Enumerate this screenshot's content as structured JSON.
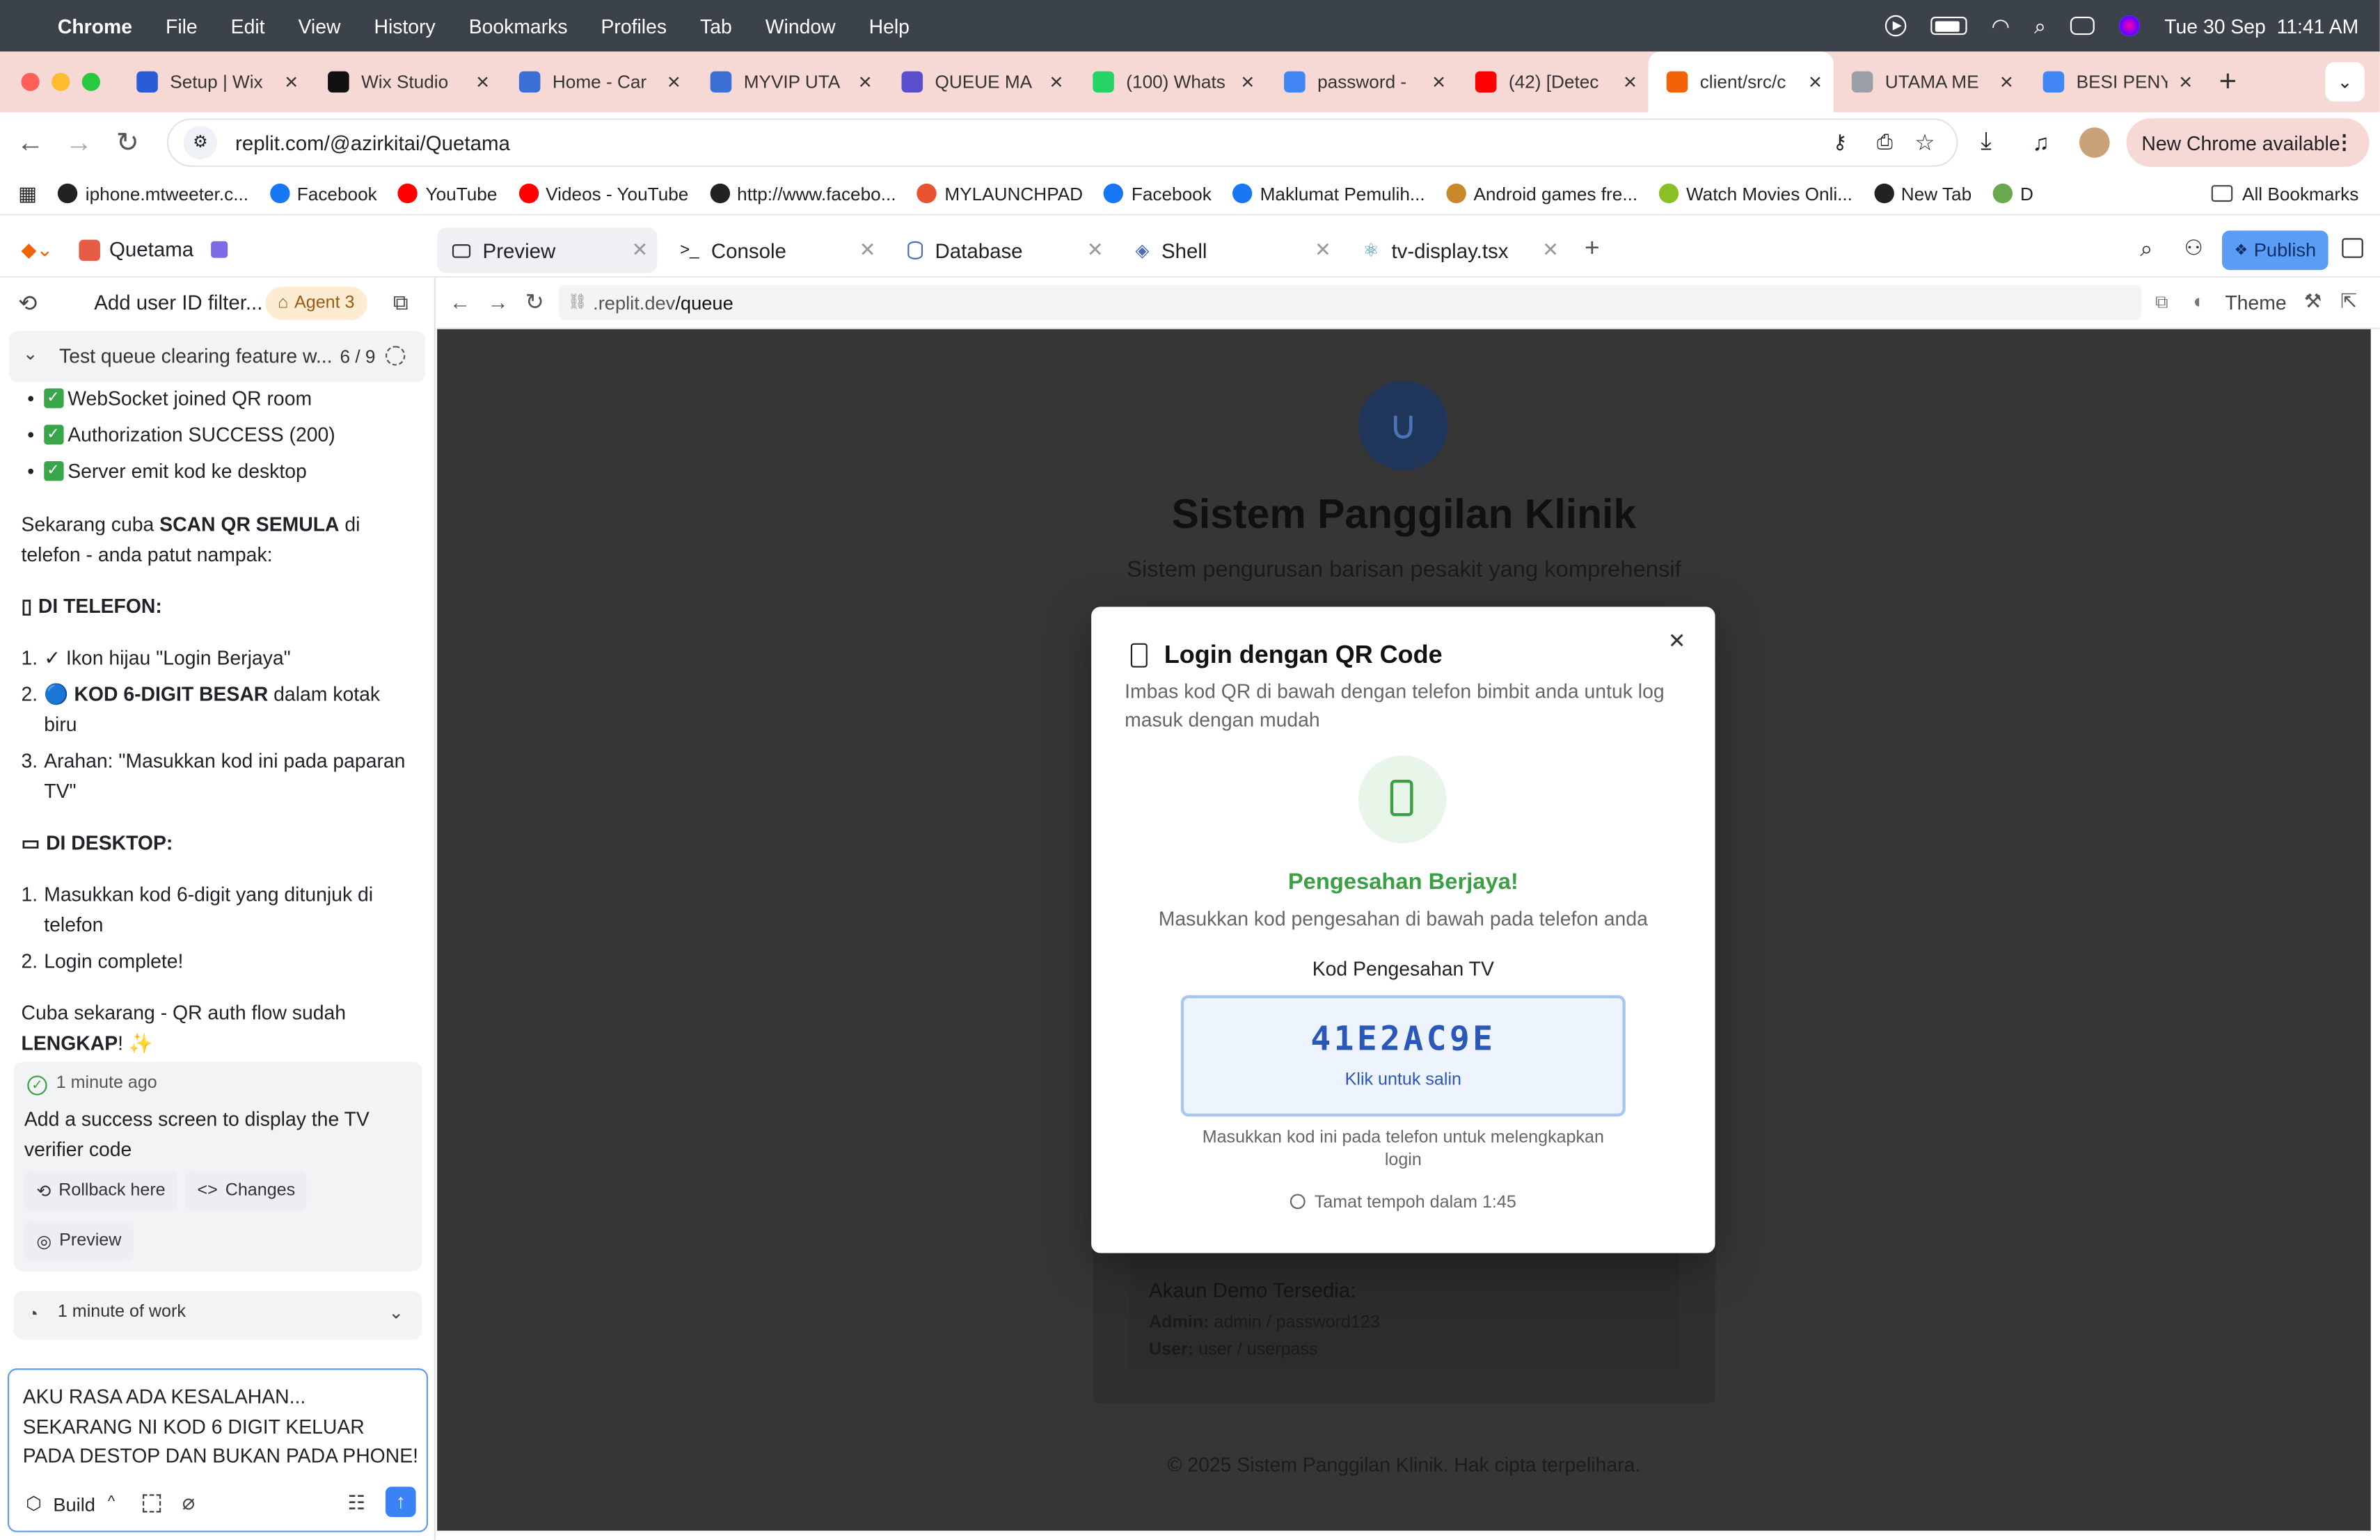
{
  "menubar": {
    "app": "Chrome",
    "items": [
      "File",
      "Edit",
      "View",
      "History",
      "Bookmarks",
      "Profiles",
      "Tab",
      "Window",
      "Help"
    ],
    "datetime": "Tue 30 Sep  11:41 AM"
  },
  "tabs": [
    {
      "title": "Setup | Wix",
      "color": "#2b5bd7"
    },
    {
      "title": "Wix Studio",
      "color": "#111111"
    },
    {
      "title": "Home - Car",
      "color": "#3b6fd6"
    },
    {
      "title": "MYVIP UTA",
      "color": "#3b6fd6"
    },
    {
      "title": "QUEUE MA",
      "color": "#5a4fcf"
    },
    {
      "title": "(100) Whats",
      "color": "#25d366"
    },
    {
      "title": "password -",
      "color": "#4285f4"
    },
    {
      "title": "(42) [Detec",
      "color": "#ff0000"
    },
    {
      "title": "client/src/c",
      "color": "#f26207"
    },
    {
      "title": "UTAMA ME",
      "color": "#9aa0a6"
    },
    {
      "title": "BESI PENYA",
      "color": "#4285f4"
    }
  ],
  "address": {
    "url": "replit.com/@azirkitai/Quetama",
    "update_label": "New Chrome available"
  },
  "bookmarks": [
    {
      "label": "iphone.mtweeter.c...",
      "color": "#222222"
    },
    {
      "label": "Facebook",
      "color": "#1877f2"
    },
    {
      "label": "YouTube",
      "color": "#ff0000"
    },
    {
      "label": "Videos - YouTube",
      "color": "#ff0000"
    },
    {
      "label": "http://www.facebo...",
      "color": "#222222"
    },
    {
      "label": "MYLAUNCHPAD",
      "color": "#e8542f"
    },
    {
      "label": "Facebook",
      "color": "#1877f2"
    },
    {
      "label": "Maklumat Pemulih...",
      "color": "#1877f2"
    },
    {
      "label": "Android games fre...",
      "color": "#c9892b"
    },
    {
      "label": "Watch Movies Onli...",
      "color": "#8cbf26"
    },
    {
      "label": "New Tab",
      "color": "#222222"
    },
    {
      "label": "D",
      "color": "#6aa84f"
    }
  ],
  "bookmarks_all": "All Bookmarks",
  "replit": {
    "project": "Quetama",
    "tabs": [
      "Preview",
      "Console",
      "Database",
      "Shell",
      "tv-display.tsx"
    ],
    "publish": "Publish",
    "preview_url_prefix": ".replit.dev",
    "preview_url_path": "/queue",
    "theme_label": "Theme"
  },
  "agent": {
    "title": "Add user ID filter...",
    "badge": "Agent 3",
    "task": "Test queue clearing feature w...",
    "task_progress": "6 / 9",
    "bullets": [
      "WebSocket joined QR room",
      "Authorization SUCCESS (200)",
      "Server emit kod ke desktop"
    ],
    "para1_a": "Sekarang cuba ",
    "para1_b": "SCAN QR SEMULA",
    "para1_c": " di telefon - anda patut nampak:",
    "h_phone": "DI TELEFON:",
    "phone_steps": [
      {
        "pre": "✓ Ikon hijau \"Login Berjaya\"",
        "bold": "",
        "post": ""
      },
      {
        "pre": "🔵 ",
        "bold": "KOD 6-DIGIT BESAR",
        "post": " dalam kotak biru"
      },
      {
        "pre": "Arahan: \"Masukkan kod ini pada paparan TV\"",
        "bold": "",
        "post": ""
      }
    ],
    "h_desktop": "DI DESKTOP:",
    "desktop_steps": [
      "Masukkan kod 6-digit yang ditunjuk di telefon",
      "Login complete!"
    ],
    "para2_a": "Cuba sekarang - QR auth flow sudah ",
    "para2_b": "LENGKAP",
    "para2_c": "! ✨",
    "checkpoint_time": "1 minute ago",
    "checkpoint_text": "Add a success screen to display the TV verifier code",
    "rollback": "Rollback here",
    "changes": "Changes",
    "preview": "Preview",
    "work": "1 minute of work",
    "input": "AKU RASA ADA KESALAHAN... SEKARANG NI KOD 6 DIGIT KELUAR PADA DESTOP DAN BUKAN PADA PHONE!",
    "mode": "Build"
  },
  "app": {
    "title": "Sistem Panggilan Klinik",
    "subtitle": "Sistem pengurusan barisan pesakit yang komprehensif",
    "demo_title": "Akaun Demo Tersedia:",
    "demo_admin_label": "Admin:",
    "demo_admin": " admin / password123",
    "demo_user_label": "User:",
    "demo_user": " user / userpass",
    "footer": "© 2025 Sistem Panggilan Klinik. Hak cipta terpelihara."
  },
  "modal": {
    "title": "Login dengan QR Code",
    "desc": "Imbas kod QR di bawah dengan telefon bimbit anda untuk log masuk dengan mudah",
    "success": "Pengesahan Berjaya!",
    "instruction": "Masukkan kod pengesahan di bawah pada telefon anda",
    "code_label": "Kod Pengesahan TV",
    "code": "41E2AC9E",
    "copy_hint": "Klik untuk salin",
    "help": "Masukkan kod ini pada telefon untuk melengkapkan login",
    "expiry": "Tamat tempoh dalam 1:45"
  },
  "colors": {
    "green": "#3aa043",
    "blue": "#2b58b8",
    "publish": "#5b9df5"
  }
}
